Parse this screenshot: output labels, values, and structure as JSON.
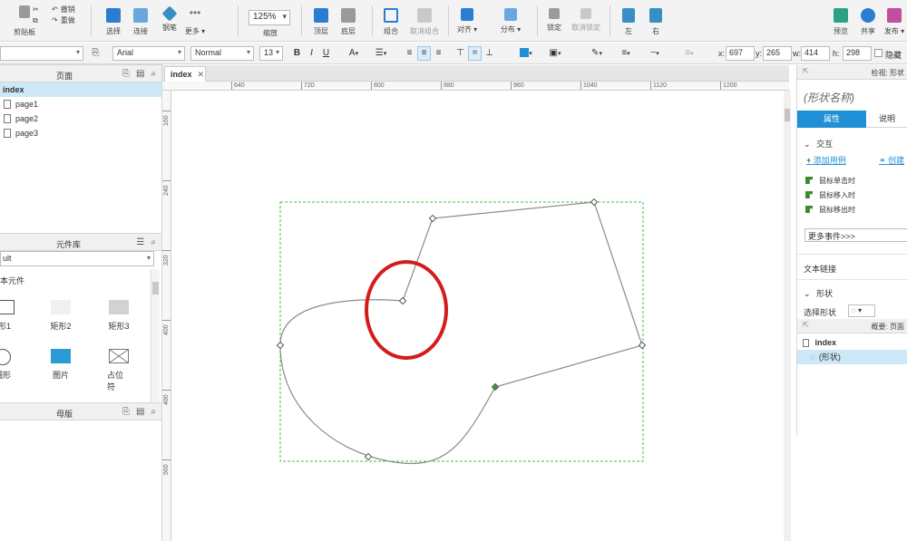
{
  "toolbar": {
    "clipboard": {
      "paste_label": "剪贴板",
      "cut_label": "剪切",
      "copy_label": "撤销",
      "redo_label": "重做"
    },
    "tools": [
      {
        "label": "选择"
      },
      {
        "label": "连接"
      },
      {
        "label": "钢笔"
      },
      {
        "label": "更多 ▾"
      }
    ],
    "zoom": {
      "value": "125%",
      "label": "缩放"
    },
    "arrange": [
      {
        "label": "顶层"
      },
      {
        "label": "底层"
      },
      {
        "label": "组合"
      },
      {
        "label": "取消组合"
      },
      {
        "label": "对齐 ▾"
      },
      {
        "label": "分布 ▾"
      },
      {
        "label": "锁定"
      },
      {
        "label": "取消锁定"
      },
      {
        "label": "左"
      },
      {
        "label": "右"
      }
    ],
    "publish": [
      {
        "label": "预览"
      },
      {
        "label": "共享"
      },
      {
        "label": "发布 ▾"
      }
    ]
  },
  "formatbar": {
    "font": "Arial",
    "weight": "Normal",
    "size": "13",
    "x_label": "x:",
    "x": "697",
    "y_label": "y:",
    "y": "265",
    "w_label": "w:",
    "w": "414",
    "h_label": "h:",
    "h": "298",
    "hide_label": "隐藏"
  },
  "pages_panel": {
    "title": "页面",
    "pages": [
      {
        "name": "index",
        "selected": true
      },
      {
        "name": "page1"
      },
      {
        "name": "page2"
      },
      {
        "name": "page3"
      }
    ]
  },
  "library_panel": {
    "title": "元件库",
    "selected_library": "ult",
    "group_title": "本元件",
    "widgets": [
      {
        "label": "形1"
      },
      {
        "label": "矩形2"
      },
      {
        "label": "矩形3"
      },
      {
        "label": "圆形"
      },
      {
        "label": "图片"
      },
      {
        "label": "占位符"
      }
    ]
  },
  "masters_panel": {
    "title": "母版"
  },
  "canvas": {
    "tab_label": "index",
    "tab_close": "✕",
    "ruler_top": [
      "640",
      "720",
      "800",
      "880",
      "960",
      "1040",
      "1120",
      "1200"
    ],
    "ruler_left": [
      "160",
      "240",
      "320",
      "400",
      "480",
      "560"
    ]
  },
  "inspector": {
    "header": "检视: 形状",
    "shape_name_placeholder": "(形状名称)",
    "tabs": {
      "properties": "属性",
      "notes": "说明"
    },
    "interaction_title": "交互",
    "add_case": "添加用例",
    "create_link": "创建",
    "events": [
      "鼠标单击时",
      "鼠标移入时",
      "鼠标移出时"
    ],
    "more_events": "更多事件>>>",
    "text_link": "文本链接",
    "shape_section": "形状",
    "select_shape": "选择形状"
  },
  "outline_panel": {
    "header": "概要: 页面",
    "items": [
      {
        "label": "index"
      },
      {
        "label": "(形状)"
      }
    ]
  },
  "colors": {
    "accent": "#1f8fd6",
    "selection_border": "#3ec43e",
    "annotation_circle": "#d41c1c",
    "path_stroke": "#8a8a8a"
  }
}
